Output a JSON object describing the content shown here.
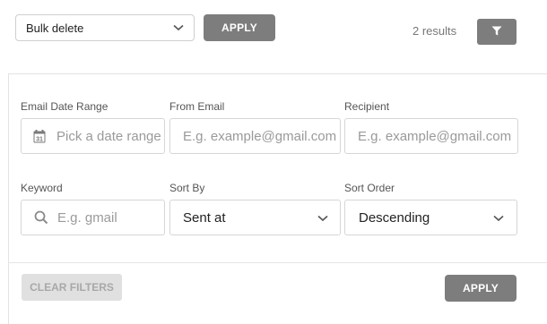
{
  "topbar": {
    "bulk_action": {
      "selected": "Bulk delete"
    },
    "apply_label": "APPLY",
    "results_text": "2 results"
  },
  "filters": {
    "email_date_range": {
      "label": "Email Date Range",
      "placeholder": "Pick a date range",
      "icon": "calendar-icon",
      "icon_day": "31"
    },
    "from_email": {
      "label": "From Email",
      "placeholder": "E.g. example@gmail.com"
    },
    "recipient": {
      "label": "Recipient",
      "placeholder": "E.g. example@gmail.com"
    },
    "keyword": {
      "label": "Keyword",
      "placeholder": "E.g. gmail",
      "icon": "search-icon"
    },
    "sort_by": {
      "label": "Sort By",
      "value": "Sent at"
    },
    "sort_order": {
      "label": "Sort Order",
      "value": "Descending"
    }
  },
  "footer": {
    "clear_label": "CLEAR FILTERS",
    "apply_label": "APPLY"
  },
  "colors": {
    "button_dark": "#7d7d7d",
    "button_disabled": "#e0e0e0",
    "border": "#d6d6d6"
  }
}
